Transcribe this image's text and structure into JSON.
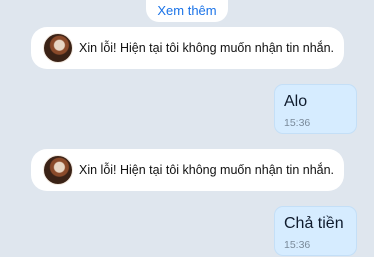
{
  "chat": {
    "see_more_label": "Xem thêm",
    "messages": [
      {
        "type": "system",
        "text": "Xin lỗi! Hiện tại tôi không muốn nhận tin nhắn."
      },
      {
        "type": "outgoing",
        "text": "Alo",
        "time": "15:36"
      },
      {
        "type": "system",
        "text": "Xin lỗi! Hiện tại tôi không muốn nhận tin nhắn."
      },
      {
        "type": "outgoing",
        "text": "Chả tiền",
        "time": "15:36"
      }
    ]
  },
  "colors": {
    "background": "#dfe6ee",
    "link": "#1a73e8",
    "outgoing_bubble": "#d6ecff"
  }
}
